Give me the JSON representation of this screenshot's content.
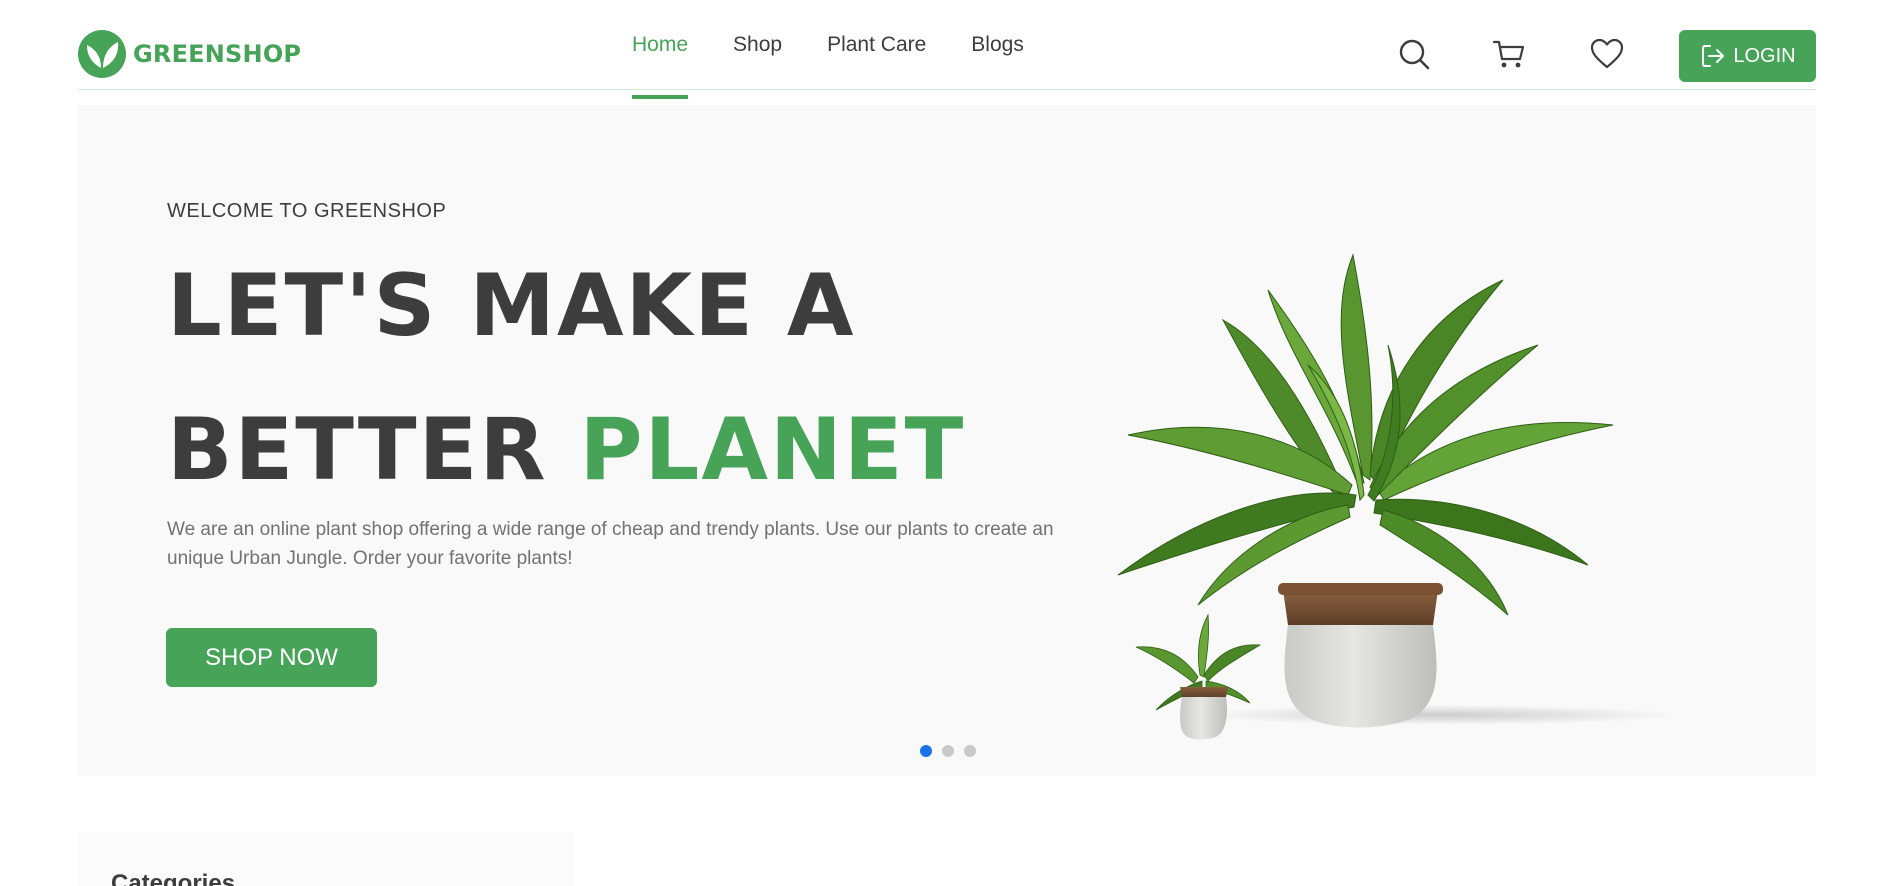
{
  "header": {
    "logo_text": "GREENSHOP",
    "nav": [
      {
        "label": "Home",
        "active": true
      },
      {
        "label": "Shop",
        "active": false
      },
      {
        "label": "Plant Care",
        "active": false
      },
      {
        "label": "Blogs",
        "active": false
      }
    ],
    "icons": [
      "search-icon",
      "cart-icon",
      "heart-icon"
    ],
    "login_label": "LOGIN"
  },
  "hero": {
    "kicker": "WELCOME TO GREENSHOP",
    "headline_line1": "LET'S MAKE A",
    "headline_line2_part1": "BETTER ",
    "headline_line2_accent": "PLANET",
    "description": "We are an online plant shop offering a wide range of cheap and trendy plants. Use our plants to create an unique Urban Jungle. Order your favorite plants!",
    "cta_label": "SHOP NOW",
    "slides_total": 3,
    "active_slide": 1
  },
  "categories": {
    "title": "Categories"
  },
  "colors": {
    "brand": "#46a358",
    "text": "#3d3d3d",
    "muted": "#727272",
    "hero_bg": "#f9f9f9",
    "active_dot": "#1a73e8"
  }
}
